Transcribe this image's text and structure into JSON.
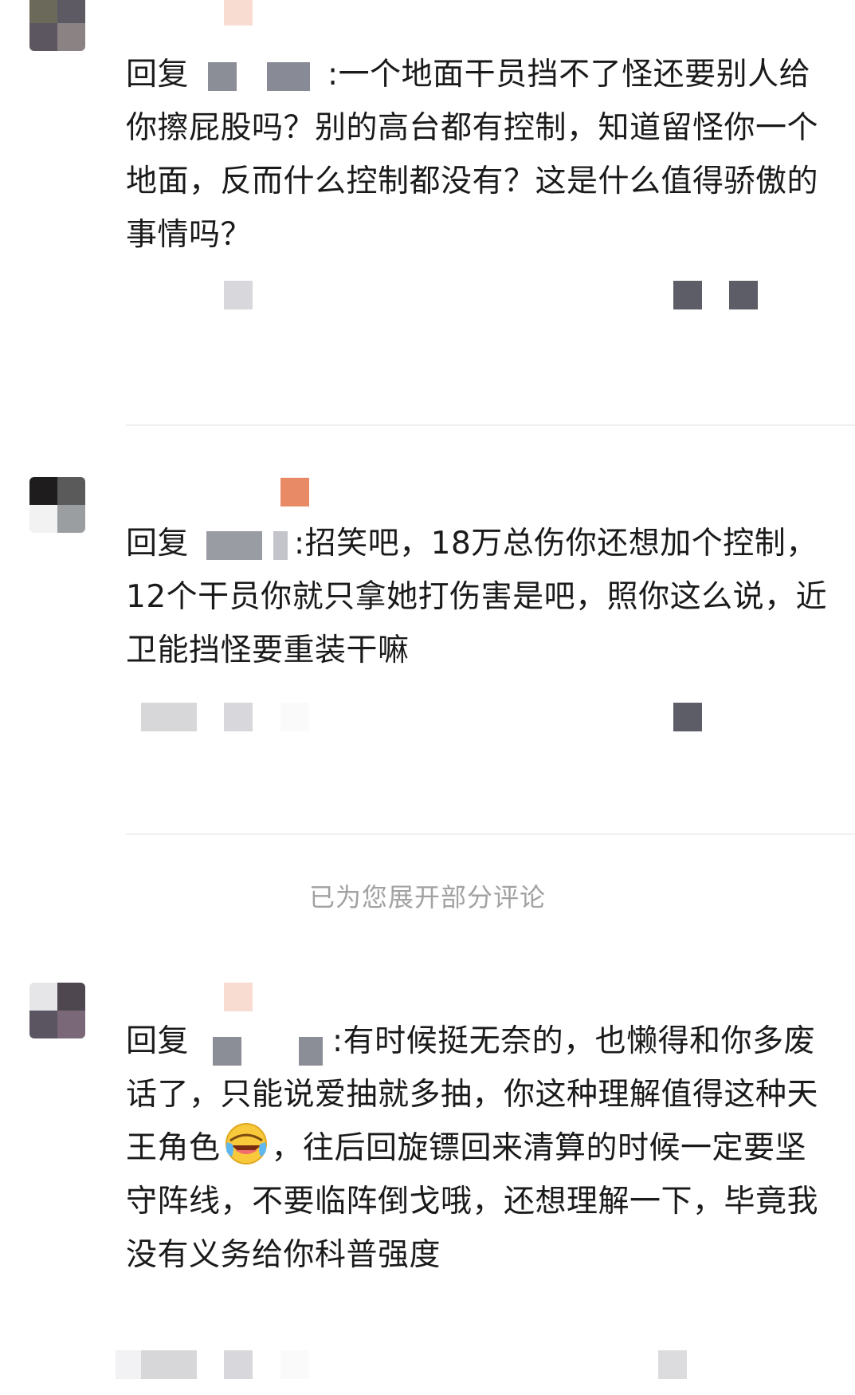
{
  "comments": [
    {
      "prefix": "回复",
      "sep": ":",
      "text": "一个地面干员挡不了怪还要别人给你擦屁股吗？别的高台都有控制，知道留怪你一个地面，反而什么控制都没有？这是什么值得骄傲的事情吗？"
    },
    {
      "prefix": "回复",
      "sep": ":",
      "text": "招笑吧，18万总伤你还想加个控制，12个干员你就只拿她打伤害是吧，照你这么说，近卫能挡怪要重装干嘛"
    },
    {
      "prefix": "回复",
      "sep": ":",
      "text_before": "有时候挺无奈的，也懒得和你多废话了，只能说爱抽就多抽，你这种理解值得这种天王角色",
      "emoji": "laughing-crying-emoji",
      "text_after": "，往后回旋镖回来清算的时候一定要坚守阵线，不要临阵倒戈哦，还想理解一下，毕竟我没有义务给你科普强度"
    }
  ],
  "expanded_note": "已为您展开部分评论",
  "colors": {
    "divider": "#f0f0f0",
    "note": "#a2a2a2",
    "text": "#1a1a1a"
  }
}
